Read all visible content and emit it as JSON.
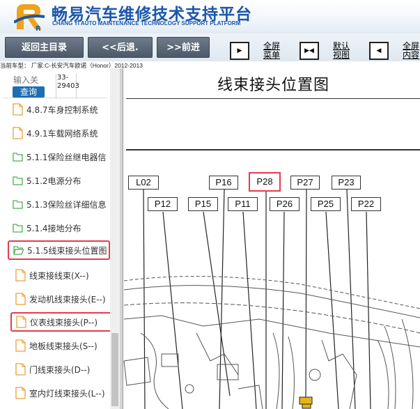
{
  "header": {
    "title_zh": "畅易汽车维修技术支持平台",
    "title_en": "CHANG YI AUTO MAINTENANCE TECHNOLOGY SUPPORT PLATFORM",
    "logo_letter": "R"
  },
  "toolbar": {
    "home": "返回主目录",
    "back": "<<后退.",
    "forward": ">>前进",
    "fullscreen_menu": [
      "全屏",
      "菜单"
    ],
    "default_view": [
      "默认",
      "视图"
    ],
    "fullscreen_content": [
      "全屏",
      "内容"
    ]
  },
  "vehicle_info": "当前车型： 厂家:C-长安汽车欧诺（Honor）2012-2013",
  "search": {
    "placeholder": "输入关",
    "button": "查询",
    "code_line1": "33-",
    "code_line2": "29403"
  },
  "tree": [
    {
      "label": "4.8.7车身控制系统",
      "icon": "document-icon"
    },
    {
      "label": "4.9.1车载网络系统",
      "icon": "document-icon"
    },
    {
      "label": "5.1.1保险丝继电器信",
      "icon": "folder-icon"
    },
    {
      "label": "5.1.2电源分布",
      "icon": "folder-icon"
    },
    {
      "label": "5.1.3保险丝详细信息",
      "icon": "folder-icon"
    },
    {
      "label": "5.1.4接地分布",
      "icon": "folder-icon"
    },
    {
      "label": "5.1.5线束接头位置图",
      "icon": "folder-open-icon"
    },
    {
      "label": "线束接线束(X--)",
      "icon": "document-icon"
    },
    {
      "label": "发动机线束接头(E--)",
      "icon": "document-icon"
    },
    {
      "label": "仪表线束接头(P--)",
      "icon": "document-icon"
    },
    {
      "label": "地板线束接头(S--)",
      "icon": "document-icon"
    },
    {
      "label": "门线束接头(D--)",
      "icon": "document-icon"
    },
    {
      "label": "室内灯线束接头(L--)",
      "icon": "document-icon"
    }
  ],
  "document": {
    "title": "线束接头位置图",
    "connectors_row1": [
      "L02",
      "P16",
      "P28",
      "P27",
      "P23"
    ],
    "connectors_row2": [
      "P12",
      "P15",
      "P11",
      "P26",
      "P25",
      "P22"
    ],
    "highlighted_connector": "P28"
  },
  "colors": {
    "brand_blue": "#1b56a8",
    "highlight_red": "#e63a4d",
    "toolbar_button": "#5a6675",
    "folder_green": "#4caf50",
    "document_orange": "#e9a23b"
  }
}
